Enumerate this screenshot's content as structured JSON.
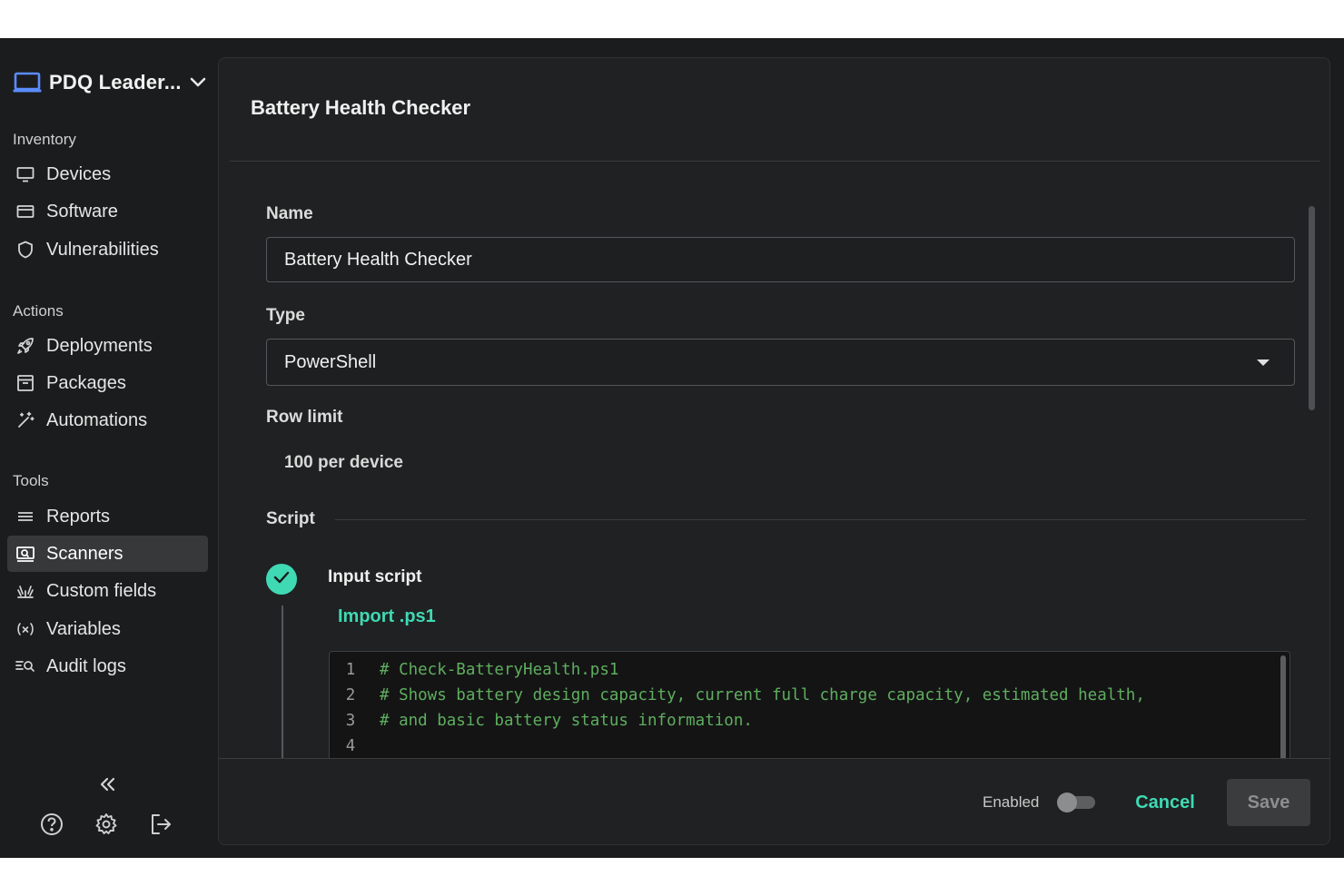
{
  "colors": {
    "accent": "#3fd9b4",
    "background": "#1b1c1d",
    "panel": "#202122",
    "active_nav": "#36383a",
    "code_comment": "#5fae5f"
  },
  "sidebar": {
    "org_name": "PDQ Leader...",
    "org_icon": "laptop-icon",
    "sections": [
      {
        "label": "Inventory",
        "items": [
          {
            "label": "Devices",
            "icon": "monitor-icon"
          },
          {
            "label": "Software",
            "icon": "window-icon"
          },
          {
            "label": "Vulnerabilities",
            "icon": "shield-icon"
          }
        ]
      },
      {
        "label": "Actions",
        "items": [
          {
            "label": "Deployments",
            "icon": "rocket-icon"
          },
          {
            "label": "Packages",
            "icon": "package-icon"
          },
          {
            "label": "Automations",
            "icon": "magic-wand-icon"
          }
        ]
      },
      {
        "label": "Tools",
        "items": [
          {
            "label": "Reports",
            "icon": "list-icon"
          },
          {
            "label": "Scanners",
            "icon": "scanner-icon",
            "active": true
          },
          {
            "label": "Custom fields",
            "icon": "custom-fields-icon"
          },
          {
            "label": "Variables",
            "icon": "variable-icon"
          },
          {
            "label": "Audit logs",
            "icon": "audit-search-icon"
          }
        ]
      }
    ],
    "footer_icons": [
      "help-icon",
      "settings-gear-icon",
      "logout-icon"
    ],
    "collapse_icon": "double-chevron-left-icon"
  },
  "form": {
    "title": "Battery Health Checker",
    "name_label": "Name",
    "name_value": "Battery Health Checker",
    "type_label": "Type",
    "type_value": "PowerShell",
    "row_limit_label": "Row limit",
    "row_limit_value": "100 per device",
    "script_label": "Script",
    "step_title": "Input script",
    "import_label": "Import .ps1",
    "code_lines": [
      {
        "n": "1",
        "text": "# Check-BatteryHealth.ps1"
      },
      {
        "n": "2",
        "text": "# Shows battery design capacity, current full charge capacity, estimated health,"
      },
      {
        "n": "3",
        "text": "# and basic battery status information."
      },
      {
        "n": "4",
        "text": ""
      }
    ]
  },
  "footer": {
    "enabled_label": "Enabled",
    "enabled": false,
    "cancel_label": "Cancel",
    "save_label": "Save"
  }
}
